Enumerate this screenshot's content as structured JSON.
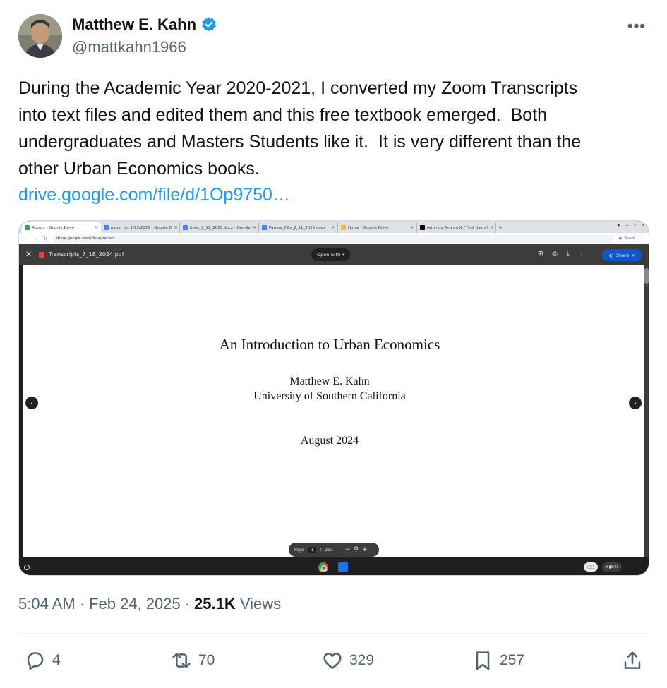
{
  "author": {
    "name": "Matthew E. Kahn",
    "handle": "@mattkahn1966",
    "verified_color": "#1d9bf0"
  },
  "more_label": "•••",
  "tweet": {
    "text": "During the Academic Year 2020-2021, I converted my Zoom Transcripts\ninto text files and edited them and this free textbook emerged.  Both\nundergraduates and Masters Students like it.  It is very different than the\nother Urban Economics books.",
    "link": "drive.google.com/file/d/1Op9750…"
  },
  "screenshot": {
    "tabs": [
      {
        "label": "Recent - Google Drive",
        "active": true
      },
      {
        "label": "paper list 1/25/2025 - Google D",
        "active": false
      },
      {
        "label": "book_2_12_2025.docx - Google",
        "active": false
      },
      {
        "label": "Pardoa_City_2_11_2025.docx",
        "active": false
      },
      {
        "label": "Home - Google Drive",
        "active": false
      },
      {
        "label": "Amanda Ang on X: \"First day of",
        "active": false
      }
    ],
    "new_tab": "+",
    "url": "drive.google.com/drive/recent",
    "guest_label": "Guest",
    "file_name": "Transcripts_7_18_2024.pdf",
    "open_with": "Open with",
    "share_label": "Share",
    "document": {
      "title": "An Introduction to Urban Economics",
      "author": "Matthew E. Kahn",
      "institution": "University of Southern California",
      "date": "August 2024"
    },
    "page_toolbar": {
      "page_label": "Page",
      "current_page": "1",
      "separator": "/",
      "total_pages": "293"
    },
    "time": "5:01"
  },
  "meta": {
    "time": "5:04 AM",
    "date": "Feb 24, 2025",
    "views_count": "25.1K",
    "views_label": "Views"
  },
  "actions": {
    "replies": "4",
    "reposts": "70",
    "likes": "329",
    "bookmarks": "257"
  }
}
